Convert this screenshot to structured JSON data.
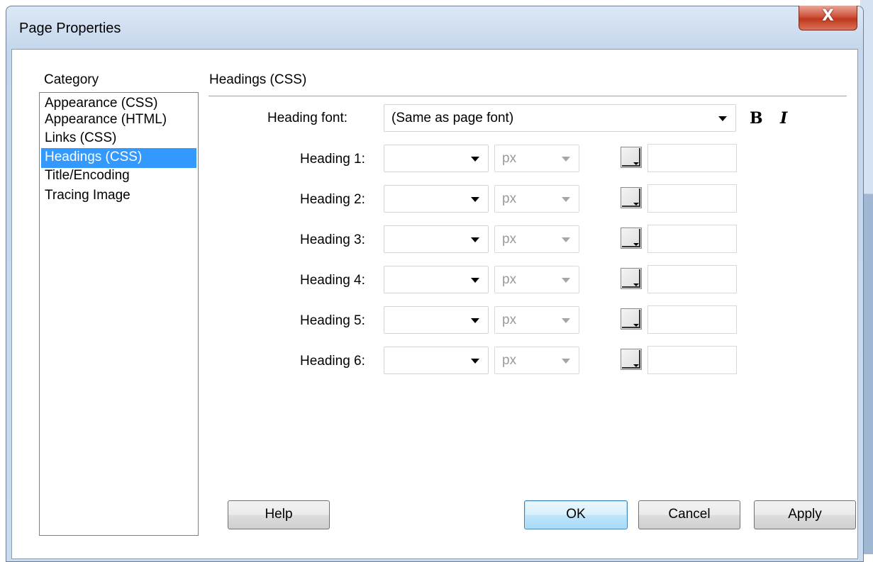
{
  "window": {
    "title": "Page Properties",
    "close_symbol": "X"
  },
  "category": {
    "label": "Category",
    "items": [
      {
        "label": "Appearance (CSS)"
      },
      {
        "label": "Appearance (HTML)"
      },
      {
        "label": "Links (CSS)"
      },
      {
        "label": "Headings (CSS)"
      },
      {
        "label": "Title/Encoding"
      },
      {
        "label": "Tracing Image"
      }
    ],
    "selected": "Headings (CSS)"
  },
  "section": {
    "title": "Headings (CSS)"
  },
  "heading_font": {
    "label": "Heading font:",
    "value": "(Same as page font)",
    "bold_glyph": "B",
    "italic_glyph": "I"
  },
  "headings": [
    {
      "label": "Heading 1:",
      "size": "",
      "unit": "px",
      "color": ""
    },
    {
      "label": "Heading 2:",
      "size": "",
      "unit": "px",
      "color": ""
    },
    {
      "label": "Heading 3:",
      "size": "",
      "unit": "px",
      "color": ""
    },
    {
      "label": "Heading 4:",
      "size": "",
      "unit": "px",
      "color": ""
    },
    {
      "label": "Heading 5:",
      "size": "",
      "unit": "px",
      "color": ""
    },
    {
      "label": "Heading 6:",
      "size": "",
      "unit": "px",
      "color": ""
    }
  ],
  "buttons": {
    "help": "Help",
    "ok": "OK",
    "cancel": "Cancel",
    "apply": "Apply"
  },
  "colors": {
    "selection": "#3399ff",
    "close": "#c0371c",
    "title_bar": "#c5d7ec"
  }
}
